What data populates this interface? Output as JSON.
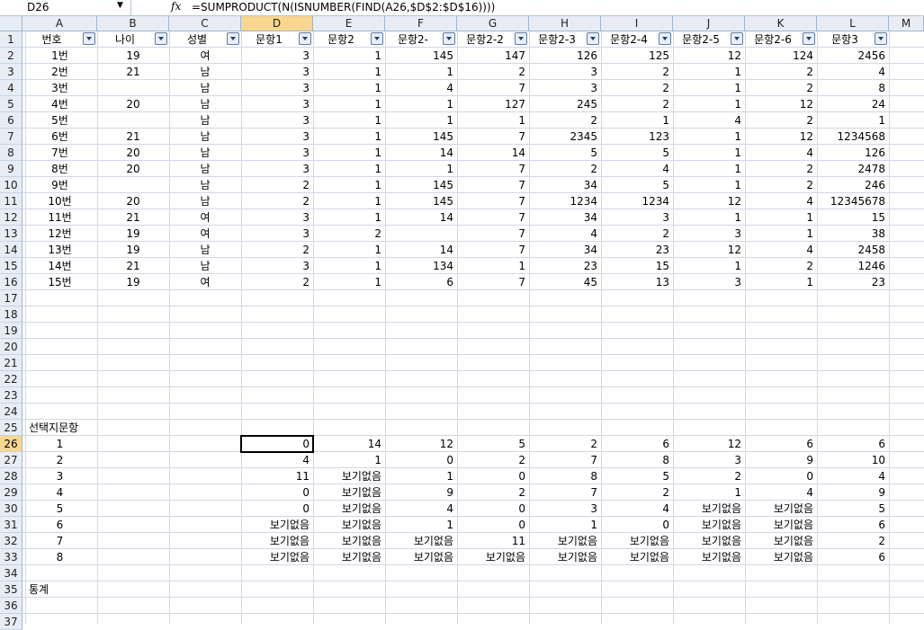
{
  "formula_bar": {
    "name_box": "D26",
    "fx_label": "fx",
    "formula": "=SUMPRODUCT(N(ISNUMBER(FIND(A26,$D$2:$D$16))))"
  },
  "columns": [
    "A",
    "B",
    "C",
    "D",
    "E",
    "F",
    "G",
    "H",
    "I",
    "J",
    "K",
    "L",
    "M"
  ],
  "selected_column": "D",
  "selected_row": 26,
  "header_row": [
    "번호",
    "나이",
    "성별",
    "문항1",
    "문항2",
    "문항2-",
    "문항2-2",
    "문항2-3",
    "문항2-4",
    "문항2-5",
    "문항2-6",
    "문항3"
  ],
  "data_rows": [
    [
      "1번",
      "19",
      "여",
      "3",
      "1",
      "145",
      "147",
      "126",
      "125",
      "12",
      "124",
      "2456"
    ],
    [
      "2번",
      "21",
      "남",
      "3",
      "1",
      "1",
      "2",
      "3",
      "2",
      "1",
      "2",
      "4"
    ],
    [
      "3번",
      "",
      "남",
      "3",
      "1",
      "4",
      "7",
      "3",
      "2",
      "1",
      "2",
      "8"
    ],
    [
      "4번",
      "20",
      "남",
      "3",
      "1",
      "1",
      "127",
      "245",
      "2",
      "1",
      "12",
      "24"
    ],
    [
      "5번",
      "",
      "남",
      "3",
      "1",
      "1",
      "1",
      "2",
      "1",
      "4",
      "2",
      "1"
    ],
    [
      "6번",
      "21",
      "남",
      "3",
      "1",
      "145",
      "7",
      "2345",
      "123",
      "1",
      "12",
      "1234568"
    ],
    [
      "7번",
      "20",
      "남",
      "3",
      "1",
      "14",
      "14",
      "5",
      "5",
      "1",
      "4",
      "126"
    ],
    [
      "8번",
      "20",
      "남",
      "3",
      "1",
      "1",
      "7",
      "2",
      "4",
      "1",
      "2",
      "2478"
    ],
    [
      "9번",
      "",
      "남",
      "2",
      "1",
      "145",
      "7",
      "34",
      "5",
      "1",
      "2",
      "246"
    ],
    [
      "10번",
      "20",
      "남",
      "2",
      "1",
      "145",
      "7",
      "1234",
      "1234",
      "12",
      "4",
      "12345678"
    ],
    [
      "11번",
      "21",
      "여",
      "3",
      "1",
      "14",
      "7",
      "34",
      "3",
      "1",
      "1",
      "15"
    ],
    [
      "12번",
      "19",
      "여",
      "3",
      "2",
      "",
      "7",
      "4",
      "2",
      "3",
      "1",
      "38"
    ],
    [
      "13번",
      "19",
      "남",
      "2",
      "1",
      "14",
      "7",
      "34",
      "23",
      "12",
      "4",
      "2458"
    ],
    [
      "14번",
      "21",
      "남",
      "3",
      "1",
      "134",
      "1",
      "23",
      "15",
      "1",
      "2",
      "1246"
    ],
    [
      "15번",
      "19",
      "여",
      "2",
      "1",
      "6",
      "7",
      "45",
      "13",
      "3",
      "1",
      "23"
    ]
  ],
  "section_label": "선택지문항",
  "choice_rows": [
    [
      "1",
      "",
      "",
      "0",
      "14",
      "12",
      "5",
      "2",
      "6",
      "12",
      "6",
      "6"
    ],
    [
      "2",
      "",
      "",
      "4",
      "1",
      "0",
      "2",
      "7",
      "8",
      "3",
      "9",
      "10"
    ],
    [
      "3",
      "",
      "",
      "11",
      "보기없음",
      "1",
      "0",
      "8",
      "5",
      "2",
      "0",
      "4"
    ],
    [
      "4",
      "",
      "",
      "0",
      "보기없음",
      "9",
      "2",
      "7",
      "2",
      "1",
      "4",
      "9"
    ],
    [
      "5",
      "",
      "",
      "0",
      "보기없음",
      "4",
      "0",
      "3",
      "4",
      "보기없음",
      "보기없음",
      "5"
    ],
    [
      "6",
      "",
      "",
      "보기없음",
      "보기없음",
      "1",
      "0",
      "1",
      "0",
      "보기없음",
      "보기없음",
      "6"
    ],
    [
      "7",
      "",
      "",
      "보기없음",
      "보기없음",
      "보기없음",
      "11",
      "보기없음",
      "보기없음",
      "보기없음",
      "보기없음",
      "2"
    ],
    [
      "8",
      "",
      "",
      "보기없음",
      "보기없음",
      "보기없음",
      "보기없음",
      "보기없음",
      "보기없음",
      "보기없음",
      "보기없음",
      "6"
    ]
  ],
  "stats_label": "통계",
  "row_numbers": [
    "1",
    "2",
    "3",
    "4",
    "5",
    "6",
    "7",
    "8",
    "9",
    "10",
    "11",
    "12",
    "13",
    "14",
    "15",
    "16",
    "17",
    "18",
    "19",
    "20",
    "21",
    "22",
    "23",
    "24",
    "25",
    "26",
    "27",
    "28",
    "29",
    "30",
    "31",
    "32",
    "33",
    "34",
    "35",
    "36",
    "37"
  ]
}
